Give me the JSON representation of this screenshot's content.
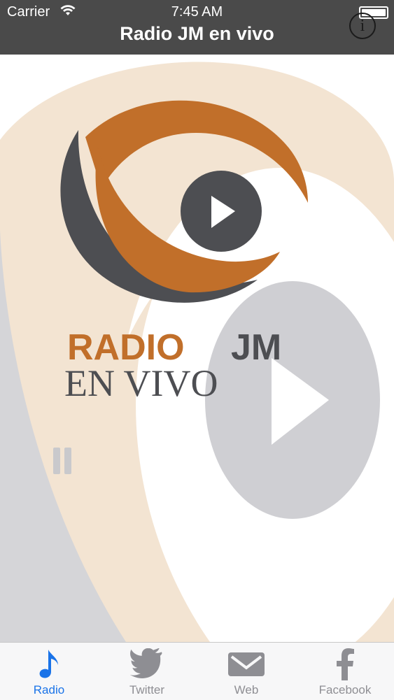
{
  "status_bar": {
    "carrier": "Carrier",
    "time": "7:45 AM"
  },
  "nav": {
    "title": "Radio JM en vivo",
    "info_icon": "info-icon"
  },
  "logo": {
    "line1_part1": "RADIO",
    "line1_part2": "JM",
    "line2": "EN VIVO"
  },
  "colors": {
    "orange": "#c16f2a",
    "dark": "#4d4e52",
    "beige": "#f0e0cc",
    "tab_active": "#1a73e8",
    "tab_inactive": "#8e8e93"
  },
  "tabs": [
    {
      "label": "Radio",
      "icon": "music-note-icon",
      "active": true
    },
    {
      "label": "Twitter",
      "icon": "twitter-bird-icon",
      "active": false
    },
    {
      "label": "Web",
      "icon": "envelope-icon",
      "active": false
    },
    {
      "label": "Facebook",
      "icon": "facebook-icon",
      "active": false
    }
  ]
}
